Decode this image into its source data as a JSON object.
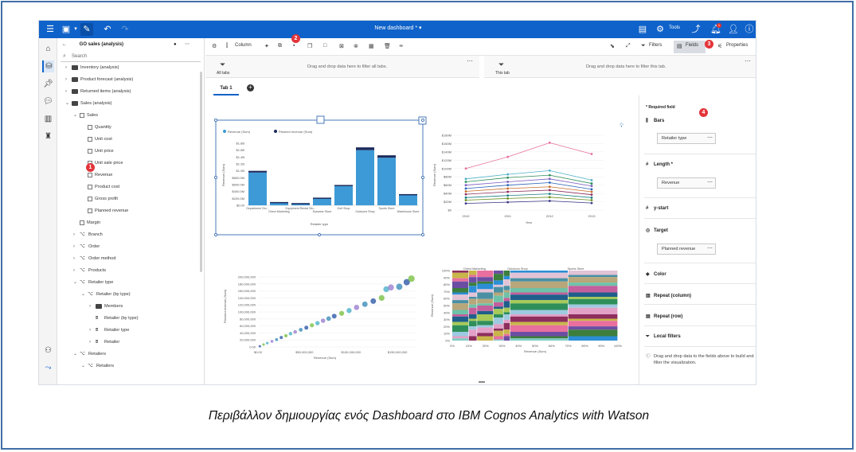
{
  "topbar": {
    "title": "New dashboard *",
    "tools_label": "Tools",
    "notification_count": "1"
  },
  "source_panel": {
    "title": "GO sales (analysis)",
    "search_placeholder": "Search",
    "tree": [
      {
        "label": "Inventory (analysis)",
        "type": "folder",
        "level": 0,
        "expanded": false
      },
      {
        "label": "Product forecast (analysis)",
        "type": "folder",
        "level": 0,
        "expanded": false
      },
      {
        "label": "Returned items (analysis)",
        "type": "folder",
        "level": 0,
        "expanded": false
      },
      {
        "label": "Sales (analysis)",
        "type": "folder",
        "level": 0,
        "expanded": true
      },
      {
        "label": "Sales",
        "type": "table",
        "level": 1,
        "expanded": true
      },
      {
        "label": "Quantity",
        "type": "measure",
        "level": 2
      },
      {
        "label": "Unit cost",
        "type": "measure",
        "level": 2
      },
      {
        "label": "Unit price",
        "type": "measure",
        "level": 2
      },
      {
        "label": "Unit sale price",
        "type": "measure",
        "level": 2
      },
      {
        "label": "Revenue",
        "type": "measure",
        "level": 2
      },
      {
        "label": "Product cost",
        "type": "measure",
        "level": 2
      },
      {
        "label": "Gross profit",
        "type": "measure",
        "level": 2
      },
      {
        "label": "Planned revenue",
        "type": "measure",
        "level": 2
      },
      {
        "label": "Margin",
        "type": "table",
        "level": 1
      },
      {
        "label": "Branch",
        "type": "dimension",
        "level": 1,
        "expanded": false
      },
      {
        "label": "Order",
        "type": "dimension",
        "level": 1,
        "expanded": false
      },
      {
        "label": "Order method",
        "type": "dimension",
        "level": 1,
        "expanded": false
      },
      {
        "label": "Products",
        "type": "dimension",
        "level": 1,
        "expanded": false
      },
      {
        "label": "Retailer type",
        "type": "dimension",
        "level": 1,
        "expanded": true
      },
      {
        "label": "Retailer (by type)",
        "type": "hierarchy",
        "level": 2,
        "expanded": true
      },
      {
        "label": "Members",
        "type": "folder",
        "level": 3,
        "expanded": false
      },
      {
        "label": "Retailer (by type)",
        "type": "level",
        "level": 3
      },
      {
        "label": "Retailer type",
        "type": "level",
        "level": 3,
        "expanded": false
      },
      {
        "label": "Retailer",
        "type": "level",
        "level": 3,
        "expanded": false
      },
      {
        "label": "Retailers",
        "type": "dimension",
        "level": 1,
        "expanded": true
      },
      {
        "label": "Retailers",
        "type": "hierarchy",
        "level": 2,
        "expanded": true
      }
    ]
  },
  "toolbar": {
    "column_label": "Column",
    "filters_label": "Filters",
    "fields_label": "Fields",
    "properties_label": "Properties"
  },
  "filter_zones": {
    "all_tabs_label": "All tabs",
    "all_tabs_message": "Drag and drop data here to filter all tabs.",
    "this_tab_label": "This tab",
    "this_tab_message": "Drag and drop data here to filter this tab."
  },
  "tabs": {
    "tab1": "Tab 1"
  },
  "fields_panel": {
    "required_note": "* Required field",
    "bars_label": "Bars",
    "bars_value": "Retailer type",
    "length_label": "Length *",
    "length_value": "Revenue",
    "ystart_label": "y-start",
    "target_label": "Target",
    "target_value": "Planned revenue",
    "color_label": "Color",
    "repeat_col_label": "Repeat (column)",
    "repeat_row_label": "Repeat (row)",
    "local_filters_label": "Local filters",
    "drop_hint": "Drag and drop data to the fields above to build and filter the visualization."
  },
  "badges": [
    "1",
    "2",
    "3",
    "4"
  ],
  "caption": "Περιβάλλον δημιουργίας ενός Dashboard στο IBM Cognos Analytics with Watson",
  "colors": {
    "brand_blue": "#0f62c9",
    "badge_red": "#e3343a",
    "bar_blue": "#3d9ad6",
    "target_navy": "#1c2a5c"
  },
  "chart_data": [
    {
      "type": "bar",
      "legend": [
        "Revenue (Sum)",
        "Planned revenue (Sum)"
      ],
      "categories": [
        "Department Sto...",
        "Direct Marketing",
        "Equipment Rental Sto...",
        "Eyewear Store",
        "Golf Shop",
        "Outdoors Shop",
        "Sports Store",
        "Warehouse Store"
      ],
      "series": [
        {
          "name": "Revenue (Sum)",
          "values": [
            950000000,
            90000000,
            60000000,
            210000000,
            560000000,
            1600000000,
            1380000000,
            310000000
          ]
        },
        {
          "name": "Planned revenue (Sum)",
          "values": [
            1000000000,
            95000000,
            64000000,
            222000000,
            590000000,
            1680000000,
            1450000000,
            325000000
          ]
        }
      ],
      "y_ticks": [
        "$0.00",
        "$200.0M",
        "$400.0M",
        "$600.0M",
        "$800.0M",
        "$1.0B",
        "$1.2B",
        "$1.4B",
        "$1.6B",
        "$1.8B"
      ],
      "ylabel": "Revenue (Sum)",
      "xlabel": "Retailer type"
    },
    {
      "type": "line",
      "x": [
        "2010",
        "2011",
        "2012",
        "2013"
      ],
      "ylabel": "Revenue (Sum)",
      "xlabel": "Year",
      "y_ticks": [
        "$0",
        "$20M",
        "$40M",
        "$60M",
        "$80M",
        "$100M",
        "$120M",
        "$140M",
        "$160M",
        "$180M"
      ],
      "series": [
        {
          "values": [
            100000000,
            128000000,
            162000000,
            135000000
          ],
          "color": "#e86f9e"
        },
        {
          "values": [
            75000000,
            86000000,
            95000000,
            72000000
          ],
          "color": "#4cb1c9"
        },
        {
          "values": [
            68000000,
            78000000,
            84000000,
            64000000
          ],
          "color": "#2f8f5b"
        },
        {
          "values": [
            60000000,
            68000000,
            75000000,
            58000000
          ],
          "color": "#7a5fc0"
        },
        {
          "values": [
            52000000,
            60000000,
            66000000,
            50000000
          ],
          "color": "#2a62b8"
        },
        {
          "values": [
            45000000,
            52000000,
            56000000,
            44000000
          ],
          "color": "#c76d2b"
        },
        {
          "values": [
            38000000,
            44000000,
            48000000,
            37000000
          ],
          "color": "#8d2e5d"
        },
        {
          "values": [
            30000000,
            35000000,
            39000000,
            30000000
          ],
          "color": "#1c7f86"
        },
        {
          "values": [
            24000000,
            28000000,
            31000000,
            24000000
          ],
          "color": "#6b8f1e"
        },
        {
          "values": [
            16000000,
            19000000,
            22000000,
            17000000
          ],
          "color": "#3a3a8a"
        }
      ]
    },
    {
      "type": "scatter",
      "ylabel": "Planned revenue (Sum)",
      "xlabel": "Revenue (Sum)",
      "x_ticks": [
        "$0.00",
        "$50,000,000",
        "$100,000,000",
        "$150,000,000"
      ],
      "y_ticks": [
        "0.00",
        "20,000,000",
        "40,000,000",
        "60,000,000",
        "80,000,000",
        "100,000,000",
        "120,000,000",
        "140,000,000",
        "160,000,000",
        "180,000,000",
        "200,000,000"
      ],
      "points": [
        [
          2000000,
          2000000
        ],
        [
          6000000,
          7000000
        ],
        [
          10000000,
          11000000
        ],
        [
          15000000,
          16000000
        ],
        [
          20000000,
          21000000
        ],
        [
          25000000,
          27000000
        ],
        [
          30000000,
          32000000
        ],
        [
          35000000,
          38000000
        ],
        [
          40000000,
          43000000
        ],
        [
          46000000,
          49000000
        ],
        [
          52000000,
          55000000
        ],
        [
          58000000,
          62000000
        ],
        [
          64000000,
          68000000
        ],
        [
          70000000,
          75000000
        ],
        [
          76000000,
          81000000
        ],
        [
          82000000,
          88000000
        ],
        [
          90000000,
          96000000
        ],
        [
          98000000,
          104000000
        ],
        [
          106000000,
          113000000
        ],
        [
          115000000,
          122000000
        ],
        [
          124000000,
          131000000
        ],
        [
          133000000,
          140000000
        ],
        [
          138000000,
          165000000
        ],
        [
          143000000,
          170000000
        ],
        [
          152000000,
          172000000
        ],
        [
          160000000,
          185000000
        ],
        [
          165000000,
          195000000
        ]
      ]
    },
    {
      "type": "bar",
      "stacked": "100%",
      "ylabel": "Revenue (Sum)",
      "xlabel": "Revenue (Sum)",
      "groups": [
        "Direct Marketing",
        "Outdoors Shop",
        "Sports Store"
      ],
      "y_ticks": [
        "0%",
        "10%",
        "20%",
        "30%",
        "40%",
        "50%",
        "60%",
        "70%",
        "80%",
        "90%",
        "100%"
      ],
      "x_ticks": [
        "0%",
        "10%",
        "20%",
        "30%",
        "40%",
        "50%",
        "60%",
        "70%",
        "80%",
        "90%",
        "100%"
      ]
    }
  ]
}
